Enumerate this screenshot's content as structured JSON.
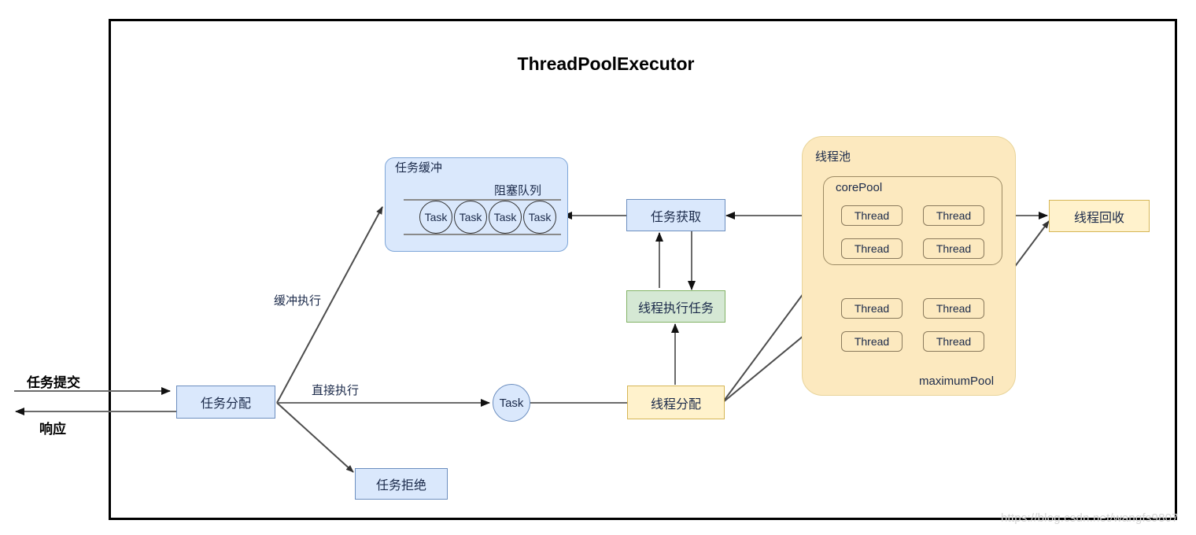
{
  "diagram": {
    "title": "ThreadPoolExecutor",
    "watermark": "https://blog.csdn.net/wangfs9807"
  },
  "io": {
    "submit_label": "任务提交",
    "response_label": "响应"
  },
  "nodes": {
    "task_dispatch": "任务分配",
    "task_reject": "任务拒绝",
    "task_circle": "Task",
    "task_fetch": "任务获取",
    "thread_execute_task": "线程执行任务",
    "thread_allocate": "线程分配",
    "thread_recycle": "线程回收"
  },
  "buffer": {
    "panel_title": "任务缓冲",
    "queue_title": "阻塞队列",
    "tasks": [
      "Task",
      "Task",
      "Task",
      "Task"
    ]
  },
  "pool": {
    "title": "线程池",
    "core_pool_title": "corePool",
    "maximum_pool_title": "maximumPool",
    "core_threads": [
      "Thread",
      "Thread",
      "Thread",
      "Thread"
    ],
    "extra_threads": [
      "Thread",
      "Thread",
      "Thread",
      "Thread"
    ]
  },
  "edges": {
    "buffer_execute": "缓冲执行",
    "direct_execute": "直接执行"
  },
  "colors": {
    "blue_fill": "#dae8fc",
    "blue_stroke": "#6c8ebf",
    "green_fill": "#d5e8d4",
    "green_stroke": "#82b366",
    "cream_fill": "#fff2cc",
    "cream_stroke": "#d6b656",
    "pool_fill": "#fce9bf",
    "frame_stroke": "#000000",
    "arrow_stroke": "#4d4d4d"
  }
}
